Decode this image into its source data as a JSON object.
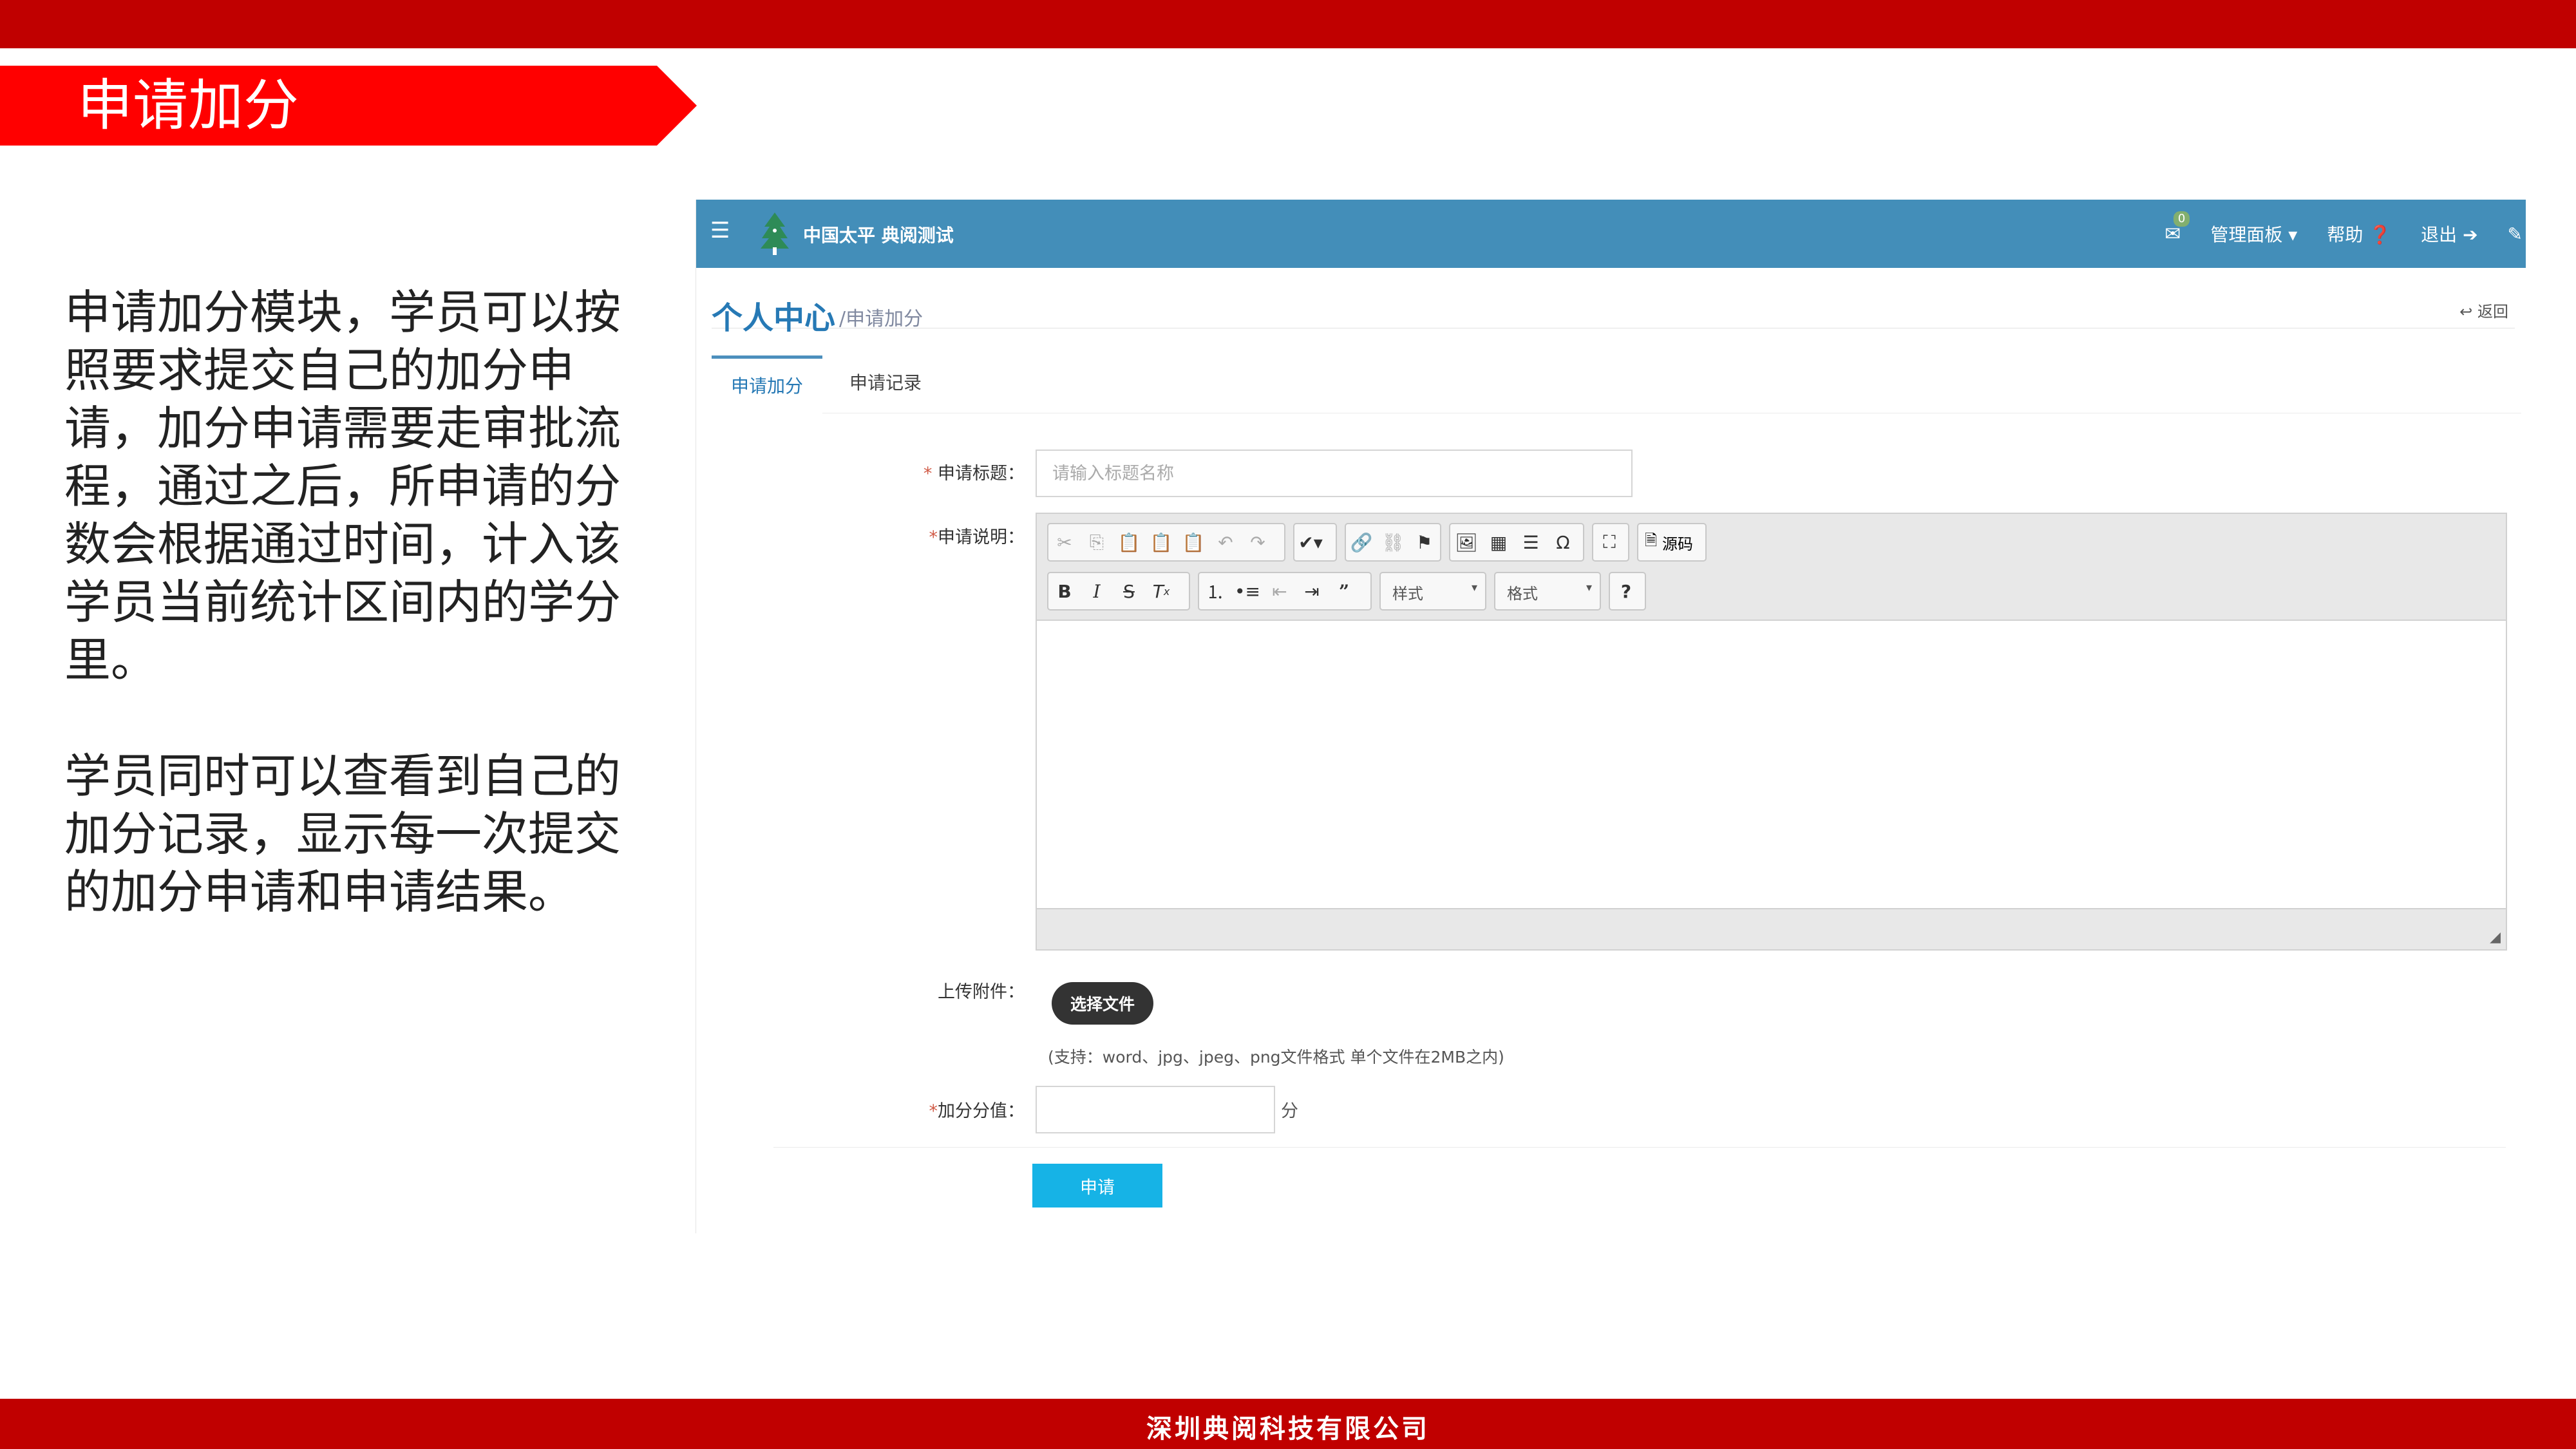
{
  "slide": {
    "title": "申请加分",
    "paragraphs": [
      "申请加分模块，学员可以按照要求提交自己的加分申请，加分申请需要走审批流程，通过之后，所申请的分数会根据通过时间，计入该学员当前统计区间内的学分里。",
      "学员同时可以查看到自己的加分记录，显示每一次提交的加分申请和申请结果。"
    ],
    "footer": "深圳典阅科技有限公司"
  },
  "app": {
    "brand": "中国太平 典阅测试",
    "nav": {
      "mail_count": "0",
      "admin_panel": "管理面板",
      "help": "帮助",
      "logout": "退出"
    },
    "page_title": "个人中心",
    "page_sub": "/申请加分",
    "back": "返回",
    "tabs": [
      "申请加分",
      "申请记录"
    ],
    "form": {
      "title_label": "申请标题：",
      "title_placeholder": "请输入标题名称",
      "desc_label": "申请说明：",
      "attach_label": "上传附件：",
      "choose_file": "选择文件",
      "hint": "(支持：word、jpg、jpeg、png文件格式   单个文件在2MB之内)",
      "score_label": "加分分值：",
      "unit": "分",
      "submit": "申请"
    },
    "editor": {
      "source": "源码",
      "style_combo": "样式",
      "format_combo": "格式",
      "help": "?"
    },
    "colors": {
      "navbar": "#438eb9",
      "submit": "#16b3e6",
      "slide_red": "#c00000",
      "ribbon_red": "#ff0000"
    }
  }
}
